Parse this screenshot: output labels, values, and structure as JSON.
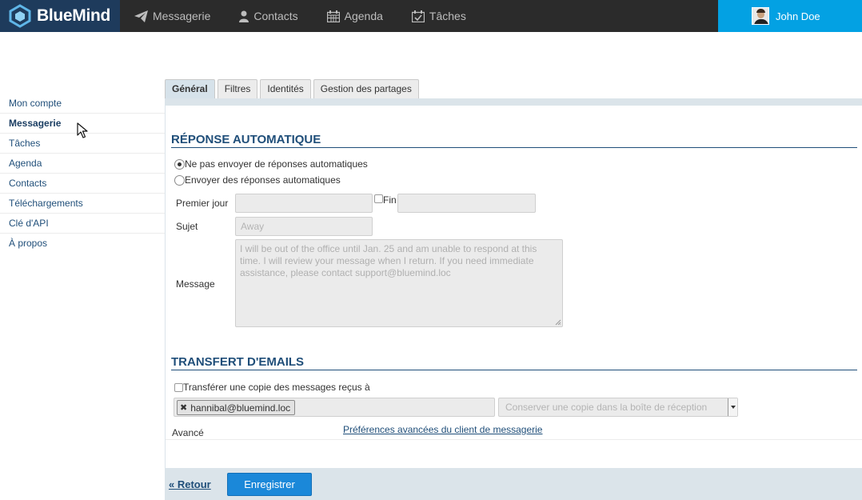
{
  "brand": {
    "name": "BlueMind"
  },
  "nav": {
    "items": [
      {
        "label": "Messagerie",
        "icon": "paper-plane-icon"
      },
      {
        "label": "Contacts",
        "icon": "person-icon"
      },
      {
        "label": "Agenda",
        "icon": "calendar-icon"
      },
      {
        "label": "Tâches",
        "icon": "task-check-icon"
      }
    ]
  },
  "user": {
    "name": "John Doe"
  },
  "sidebar": {
    "items": [
      {
        "label": "Mon compte"
      },
      {
        "label": "Messagerie"
      },
      {
        "label": "Tâches"
      },
      {
        "label": "Agenda"
      },
      {
        "label": "Contacts"
      },
      {
        "label": "Téléchargements"
      },
      {
        "label": "Clé d'API"
      },
      {
        "label": "À propos"
      }
    ],
    "active": "Messagerie"
  },
  "tabs": [
    {
      "label": "Général"
    },
    {
      "label": "Filtres"
    },
    {
      "label": "Identités"
    },
    {
      "label": "Gestion des partages"
    }
  ],
  "auto_reply": {
    "title": "RÉPONSE AUTOMATIQUE",
    "option_off": "Ne pas envoyer de réponses automatiques",
    "option_on": "Envoyer des réponses automatiques",
    "selected": "option_off",
    "first_day_label": "Premier jour",
    "end_label": "Fin",
    "subject_label": "Sujet",
    "subject_placeholder": "Away",
    "message_label": "Message",
    "message_value": "I will be out of the office until Jan. 25 and am unable to respond at this time. I will review your message when I return. If you need immediate assistance, please contact support@bluemind.loc"
  },
  "forwarding": {
    "title": "TRANSFERT D'EMAILS",
    "checkbox_label": "Transférer une copie des messages reçus à",
    "recipient": "hannibal@bluemind.loc",
    "keep_copy_option": "Conserver une copie dans la boîte de réception"
  },
  "advanced": {
    "label": "Avancé",
    "link": "Préférences avancées du client de messagerie"
  },
  "footer": {
    "back": "« Retour",
    "save": "Enregistrer"
  },
  "colors": {
    "topbar": "#2b2b2b",
    "brand_bg": "#1e3b5c",
    "user_bg": "#03a1e3",
    "accent": "#1f4e79",
    "save_button": "#1b88d9"
  }
}
